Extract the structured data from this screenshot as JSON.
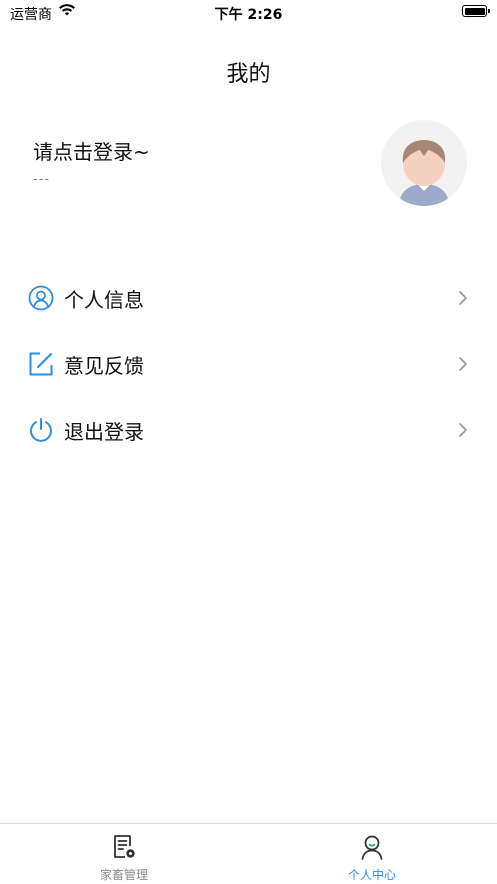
{
  "status_bar": {
    "carrier": "运营商",
    "time": "下午 2:26",
    "battery_level": 1.0
  },
  "nav": {
    "title": "我的"
  },
  "profile": {
    "login_prompt": "请点击登录~",
    "subtitle": "---",
    "avatar_icon": "default-avatar-icon"
  },
  "menu": {
    "items": [
      {
        "label": "个人信息",
        "icon": "user-circle-icon"
      },
      {
        "label": "意见反馈",
        "icon": "edit-icon"
      },
      {
        "label": "退出登录",
        "icon": "power-icon"
      }
    ]
  },
  "tab_bar": {
    "tabs": [
      {
        "label": "家畜管理",
        "icon": "document-gear-icon",
        "active": false
      },
      {
        "label": "个人中心",
        "icon": "person-icon",
        "active": true
      }
    ]
  },
  "colors": {
    "accent": "#2f8ee0",
    "inactive": "#8a8a8a",
    "chevron": "#9a9a9a"
  }
}
